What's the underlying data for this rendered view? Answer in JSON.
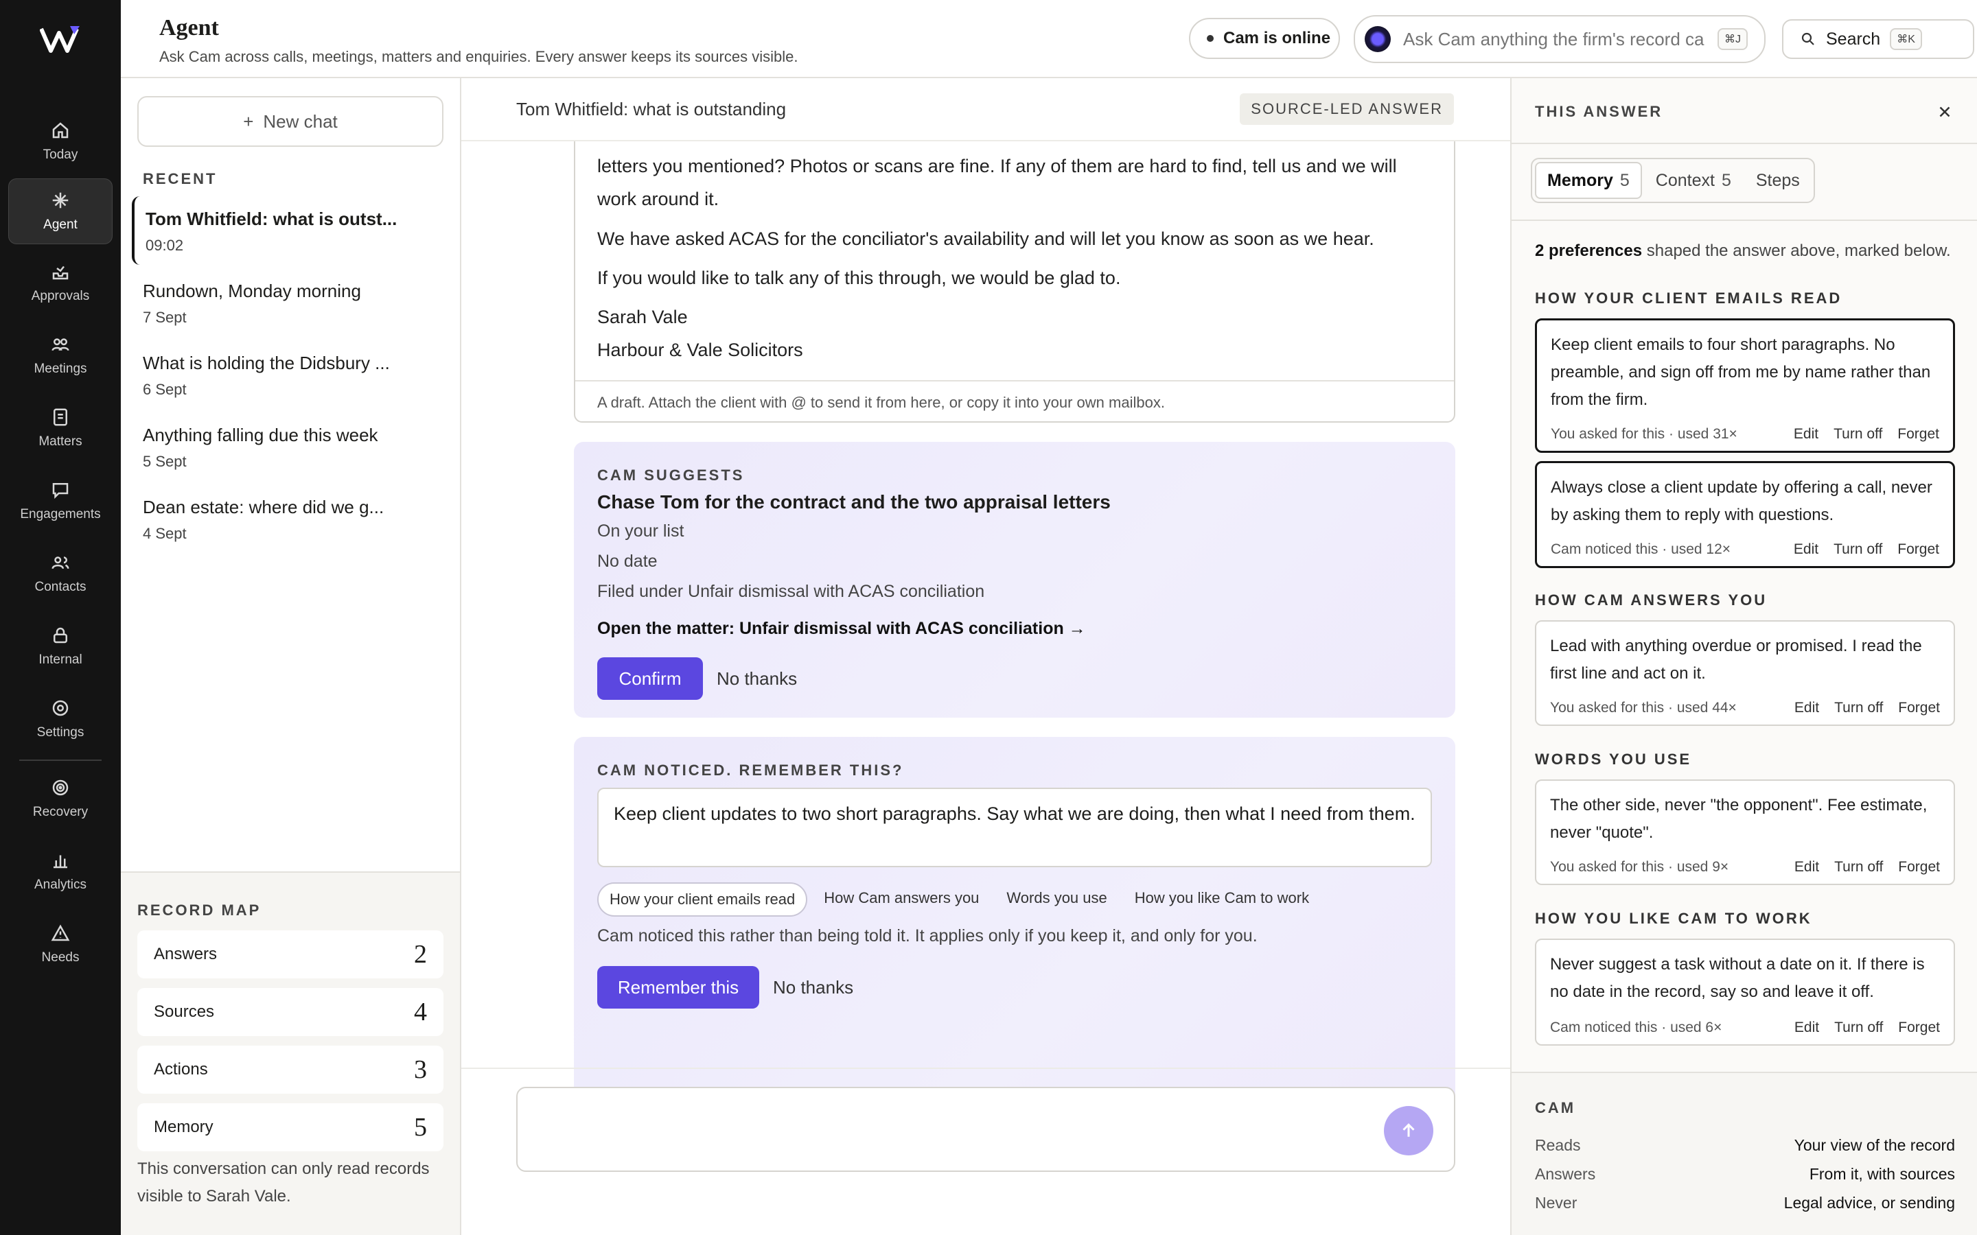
{
  "rail": {
    "items": [
      {
        "label": "Today",
        "icon": "home-icon"
      },
      {
        "label": "Agent",
        "icon": "sparkle-icon",
        "active": true
      },
      {
        "label": "Approvals",
        "icon": "inbox-icon"
      },
      {
        "label": "Meetings",
        "icon": "people-icon"
      },
      {
        "label": "Matters",
        "icon": "document-icon"
      },
      {
        "label": "Engagements",
        "icon": "chat-icon"
      },
      {
        "label": "Contacts",
        "icon": "contacts-icon"
      },
      {
        "label": "Internal",
        "icon": "lock-icon"
      },
      {
        "label": "Settings",
        "icon": "gear-icon"
      },
      {
        "label": "Recovery",
        "icon": "target-icon"
      },
      {
        "label": "Analytics",
        "icon": "bar-chart-icon"
      },
      {
        "label": "Needs",
        "icon": "warning-icon"
      }
    ]
  },
  "header": {
    "title": "Agent",
    "subtitle": "Ask Cam across calls, meetings, matters and enquiries. Every answer keeps its sources visible.",
    "status": "Cam is online",
    "ask_placeholder": "Ask Cam anything the firm's record can answer",
    "ask_shortcut": "⌘J",
    "search_label": "Search",
    "search_shortcut": "⌘K"
  },
  "left": {
    "new_chat": "New chat",
    "recent_label": "RECENT",
    "chats": [
      {
        "title": "Tom Whitfield: what is outst...",
        "date": "09:02"
      },
      {
        "title": "Rundown, Monday morning",
        "date": "7 Sept"
      },
      {
        "title": "What is holding the Didsbury ...",
        "date": "6 Sept"
      },
      {
        "title": "Anything falling due this week",
        "date": "5 Sept"
      },
      {
        "title": "Dean estate: where did we g...",
        "date": "4 Sept"
      }
    ],
    "record_map_label": "RECORD MAP",
    "record_map": [
      {
        "label": "Answers",
        "count": "2"
      },
      {
        "label": "Sources",
        "count": "4"
      },
      {
        "label": "Actions",
        "count": "3"
      },
      {
        "label": "Memory",
        "count": "5"
      }
    ],
    "note": "This conversation can only read records visible to Sarah Vale."
  },
  "main": {
    "title": "Tom Whitfield: what is outstanding",
    "badge": "SOURCE-LED ANSWER",
    "draft": {
      "line1": "letters you mentioned? Photos or scans are fine. If any of them are hard to find, tell us and we will",
      "line2": "work around it.",
      "line3": "We have asked ACAS for the conciliator's availability and will let you know as soon as we hear.",
      "line4": "If you would like to talk any of this through, we would be glad to.",
      "sign1": "Sarah Vale",
      "sign2": "Harbour & Vale Solicitors",
      "footer": "A draft. Attach the client with @ to send it from here, or copy it into your own mailbox."
    },
    "suggest": {
      "label": "CAM SUGGESTS",
      "title": "Chase Tom for the contract and the two appraisal letters",
      "line1": "On your list",
      "line2": "No date",
      "line3": "Filed under Unfair dismissal with ACAS conciliation",
      "link": "Open the matter: Unfair dismissal with ACAS conciliation →",
      "confirm": "Confirm",
      "decline": "No thanks"
    },
    "noticed": {
      "label": "CAM NOTICED. REMEMBER THIS?",
      "text": "Keep client updates to two short paragraphs. Say what we are doing, then what I need from them.",
      "tags": [
        "How your client emails read",
        "How Cam answers you",
        "Words you use",
        "How you like Cam to work"
      ],
      "selected_tag": 0,
      "note": "Cam noticed this rather than being told it. It applies only if you keep it, and only for you.",
      "remember": "Remember this",
      "decline": "No thanks"
    }
  },
  "right": {
    "header": "THIS ANSWER",
    "tabs": [
      {
        "label": "Memory",
        "count": "5"
      },
      {
        "label": "Context",
        "count": "5"
      },
      {
        "label": "Steps",
        "count": ""
      }
    ],
    "summary_bold": "2 preferences",
    "summary_rest": " shaped the answer above, marked below.",
    "groups": [
      {
        "heading": "HOW YOUR CLIENT EMAILS READ"
      },
      {
        "heading": "HOW CAM ANSWERS YOU"
      },
      {
        "heading": "WORDS YOU USE"
      },
      {
        "heading": "HOW YOU LIKE CAM TO WORK"
      }
    ],
    "prefs": [
      {
        "text": "Keep client emails to four short paragraphs. No preamble, and sign off from me by name rather than from the firm.",
        "meta": "You asked for this · used 31×"
      },
      {
        "text": "Always close a client update by offering a call, never by asking them to reply with questions.",
        "meta": "Cam noticed this · used 12×"
      },
      {
        "text": "Lead with anything overdue or promised. I read the first line and act on it.",
        "meta": "You asked for this · used 44×"
      },
      {
        "text": "The other side, never \"the opponent\". Fee estimate, never \"quote\".",
        "meta": "You asked for this · used 9×"
      },
      {
        "text": "Never suggest a task without a date on it. If there is no date in the record, say so and leave it off.",
        "meta": "Cam noticed this · used 6×"
      }
    ],
    "actions": {
      "edit": "Edit",
      "off": "Turn off",
      "forget": "Forget"
    },
    "cam": {
      "label": "CAM",
      "rows": [
        {
          "k": "Reads",
          "v": "Your view of the record"
        },
        {
          "k": "Answers",
          "v": "From it, with sources"
        },
        {
          "k": "Never",
          "v": "Legal advice, or sending"
        }
      ]
    }
  }
}
